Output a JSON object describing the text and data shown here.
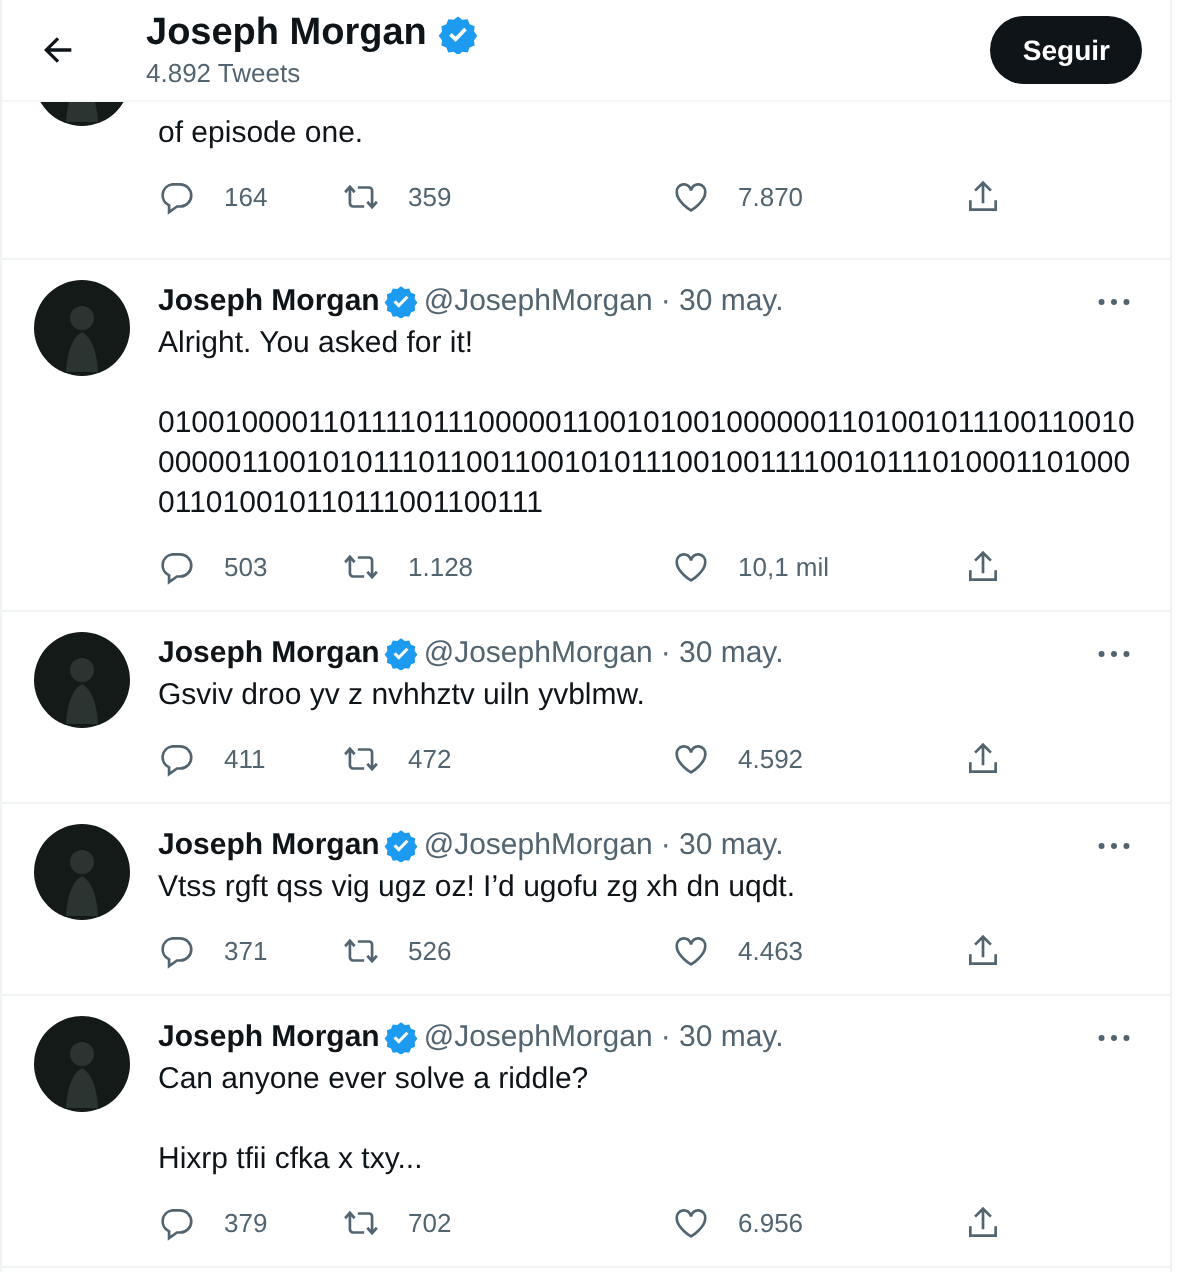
{
  "header": {
    "title": "Joseph Morgan",
    "verified": true,
    "subtitle": "4.892 Tweets",
    "follow_button": "Seguir"
  },
  "tweets": [
    {
      "kind": "cut",
      "paragraphs": [
        "of episode one."
      ],
      "replies": "164",
      "retweets": "359",
      "likes": "7.870"
    },
    {
      "kind": "full",
      "name": "Joseph Morgan",
      "verified": true,
      "handle": "@JosephMorgan",
      "date": "· 30 may.",
      "paragraphs": [
        "Alright. You asked for it!",
        "010010000110111101110000011001010010000001101001011100110010000001100101011101100110010101110010011110010111010001101000011010010110111001100111"
      ],
      "replies": "503",
      "retweets": "1.128",
      "likes": "10,1 mil"
    },
    {
      "kind": "full",
      "name": "Joseph Morgan",
      "verified": true,
      "handle": "@JosephMorgan",
      "date": "· 30 may.",
      "paragraphs": [
        "Gsviv droo yv z nvhhztv uiln yvblmw."
      ],
      "replies": "411",
      "retweets": "472",
      "likes": "4.592"
    },
    {
      "kind": "full",
      "name": "Joseph Morgan",
      "verified": true,
      "handle": "@JosephMorgan",
      "date": "· 30 may.",
      "paragraphs": [
        "Vtss rgft qss vig ugz oz! I’d ugofu zg xh dn uqdt."
      ],
      "replies": "371",
      "retweets": "526",
      "likes": "4.463"
    },
    {
      "kind": "full",
      "name": "Joseph Morgan",
      "verified": true,
      "handle": "@JosephMorgan",
      "date": "· 30 may.",
      "paragraphs": [
        "Can anyone ever solve a riddle?",
        "Hixrp tfii cfka x txy..."
      ],
      "replies": "379",
      "retweets": "702",
      "likes": "6.956"
    }
  ]
}
